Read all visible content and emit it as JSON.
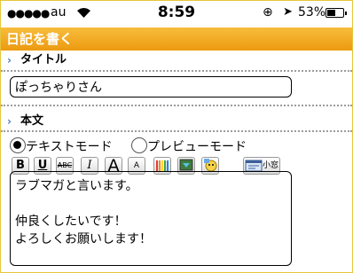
{
  "status_bar": {
    "signal": "●●●●●",
    "carrier": "au",
    "time": "8:59",
    "battery_percent": "53%",
    "battery_level": 0.53,
    "icons": [
      "wifi-icon",
      "orientation-lock-icon",
      "location-icon",
      "battery-icon"
    ]
  },
  "header": {
    "title": "日記を書く"
  },
  "title_section": {
    "label": "タイトル",
    "value": "ぽっちゃりさん"
  },
  "body_section": {
    "label": "本文",
    "modes": [
      {
        "label": "テキストモード",
        "selected": true
      },
      {
        "label": "プレビューモード",
        "selected": false
      }
    ],
    "toolbar": {
      "bold": "B",
      "underline": "U",
      "strike": "ABC",
      "italic": "I",
      "size_up": "A",
      "size_down": "A",
      "icons": [
        "color-palette-icon",
        "image-insert-icon",
        "emoji-icon"
      ],
      "small_window": "小窓"
    },
    "text_lines": [
      "ラブマガと言います。",
      "",
      "仲良くしたいです！",
      "よろしくお願いします！"
    ]
  },
  "colors": {
    "accent": "#ec9a10",
    "chevron": "#4d79b6",
    "frame": "#e6c63a"
  }
}
